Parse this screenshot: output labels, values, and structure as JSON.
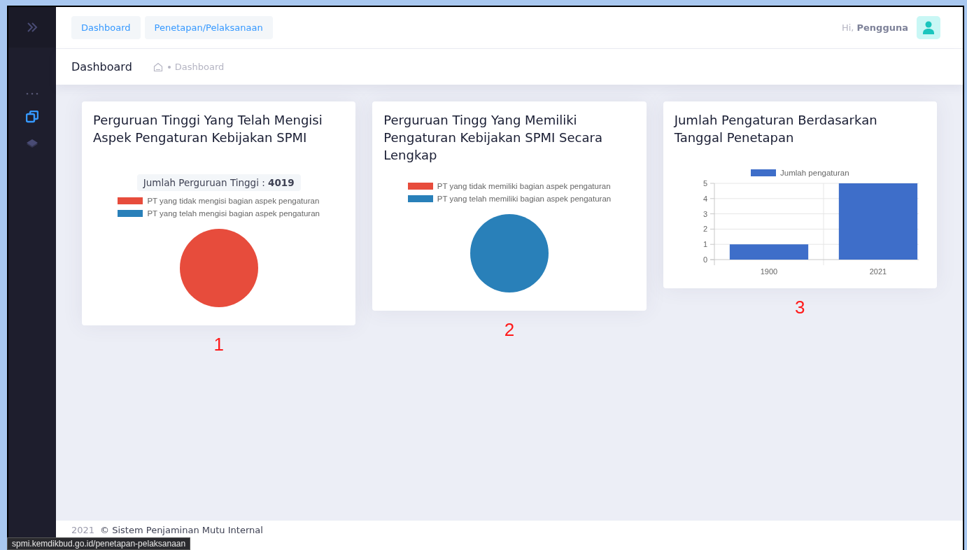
{
  "top_menu": [
    {
      "label": "Dashboard"
    },
    {
      "label": "Penetapan/Pelaksanaan"
    }
  ],
  "user": {
    "greeting": "Hi,",
    "name": "Pengguna"
  },
  "sidebar": {
    "items": [
      {
        "kind": "copy",
        "selected": true
      },
      {
        "kind": "layers",
        "selected": false
      }
    ]
  },
  "page_header": {
    "title": "Dashboard",
    "breadcrumb": "Dashboard"
  },
  "cards": [
    {
      "title": "Perguruan Tinggi Yang Telah Mengisi Aspek Pengaturan Kebijakan SPMI",
      "badge": "Jumlah Perguruan Tinggi : **4019**",
      "number": "1",
      "chart_data": {
        "type": "pie",
        "categories": [
          "PT yang tidak mengisi bagian aspek pengaturan",
          "PT yang telah mengisi bagian aspek pengaturan"
        ],
        "values": [
          1,
          0
        ],
        "colors": [
          "#e74c3c",
          "#2980b9"
        ]
      }
    },
    {
      "title": "Perguruan Tingg Yang Memiliki Pengaturan Kebijakan SPMI Secara Lengkap",
      "number": "2",
      "chart_data": {
        "type": "pie",
        "categories": [
          "PT yang tidak memiliki bagian aspek pengaturan",
          "PT yang telah memiliki bagian aspek pengaturan"
        ],
        "values": [
          0,
          1
        ],
        "colors": [
          "#e74c3c",
          "#2980b9"
        ]
      }
    },
    {
      "title": "Jumlah Pengaturan Berdasarkan Tanggal Penetapan",
      "number": "3",
      "chart_data": {
        "type": "bar",
        "categories": [
          "1900",
          "2021"
        ],
        "series": [
          {
            "name": "Jumlah pengaturan",
            "color": "#3e6ec9",
            "values": [
              1,
              5
            ]
          }
        ],
        "grid": true,
        "ylim": [
          0,
          5
        ],
        "yticks": [
          0,
          1,
          2,
          3,
          4,
          5
        ]
      }
    }
  ],
  "footer": {
    "year": "2021",
    "text": "© Sistem Penjaminan Mutu Internal"
  },
  "status_url": "spmi.kemdikbud.go.id/penetapan-pelaksanaan"
}
